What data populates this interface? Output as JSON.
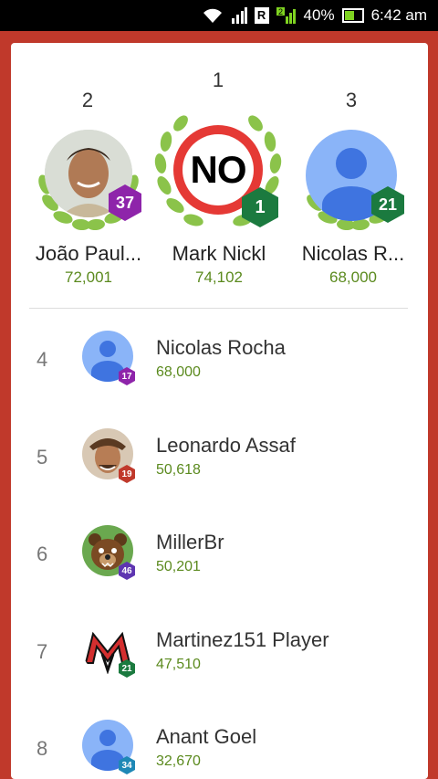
{
  "status_bar": {
    "battery": "40%",
    "time": "6:42 am",
    "sim_badge": "R",
    "network_badge": "2"
  },
  "podium": [
    {
      "rank": "2",
      "name": "João Paul...",
      "score": "72,001",
      "level": "37",
      "level_color": "#8e24aa",
      "avatar": "photo-boy"
    },
    {
      "rank": "1",
      "name": "Mark Nickl",
      "score": "74,102",
      "level": "1",
      "level_color": "#1b7a3f",
      "avatar": "no-sign",
      "avatar_text": "NO"
    },
    {
      "rank": "3",
      "name": "Nicolas R...",
      "score": "68,000",
      "level": "21",
      "level_color": "#1b7a3f",
      "avatar": "default"
    }
  ],
  "list": [
    {
      "rank": "4",
      "name": "Nicolas Rocha",
      "score": "68,000",
      "level": "17",
      "level_color": "#8e24aa",
      "avatar": "default"
    },
    {
      "rank": "5",
      "name": "Leonardo Assaf",
      "score": "50,618",
      "level": "19",
      "level_color": "#c0392b",
      "avatar": "photo-man"
    },
    {
      "rank": "6",
      "name": "MillerBr",
      "score": "50,201",
      "level": "46",
      "level_color": "#5e35b1",
      "avatar": "bear"
    },
    {
      "rank": "7",
      "name": "Martinez151 Player",
      "score": "47,510",
      "level": "21",
      "level_color": "#1b7a3f",
      "avatar": "logo-m"
    },
    {
      "rank": "8",
      "name": "Anant Goel",
      "score": "32,670",
      "level": "34",
      "level_color": "#1e88b6",
      "avatar": "default"
    }
  ]
}
